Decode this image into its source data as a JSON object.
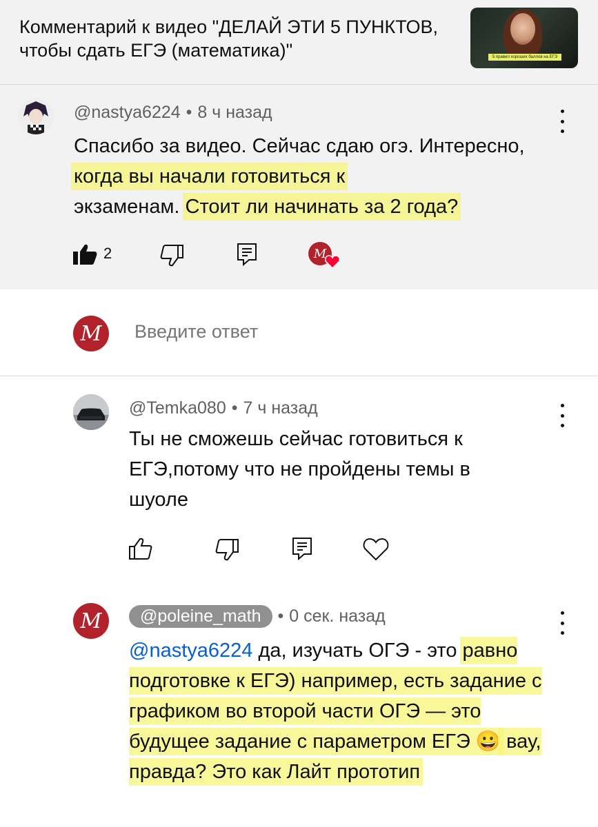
{
  "header": {
    "video_comment_title": "Комментарий к видео \"ДЕЛАЙ ЭТИ 5 ПУНКТОВ, чтобы сдать ЕГЭ (математика)\"",
    "thumbnail_caption": "5 правил хороших баллов на ЕГЭ"
  },
  "main_comment": {
    "author": "@nastya6224",
    "time": "8 ч назад",
    "text_1": "Спасибо за видео. Сейчас сдаю огэ. Интересно, ",
    "text_hl_1": "когда вы начали готовиться к",
    "text_2": "экзаменам.",
    "text_hl_2": "Стоит ли начинать за 2 года?",
    "like_count": "2"
  },
  "reply_box": {
    "avatar_letter": "M",
    "placeholder": "Введите ответ"
  },
  "replies": [
    {
      "author": "@Temka080",
      "time": "7 ч назад",
      "text": "Ты не сможешь сейчас готовиться к ЕГЭ,потому что не пройдены темы в шуоле"
    },
    {
      "author": "@poleine_math",
      "time": "0 сек. назад",
      "mention": "@nastya6224",
      "text_a": " да, изучать ОГЭ - это",
      "text_b": "равно подготовке к ЕГЭ) например, есть задание с графиком во второй части ОГЭ — это будущее задание с параметром ЕГЭ",
      "emoji": "😀",
      "text_c": " вау, правда? Это как Лайт прототип",
      "avatar_letter": "M"
    }
  ],
  "colors": {
    "highlight": "#f6f678",
    "brand_red": "#b2222b",
    "mention_blue": "#065fd4"
  }
}
